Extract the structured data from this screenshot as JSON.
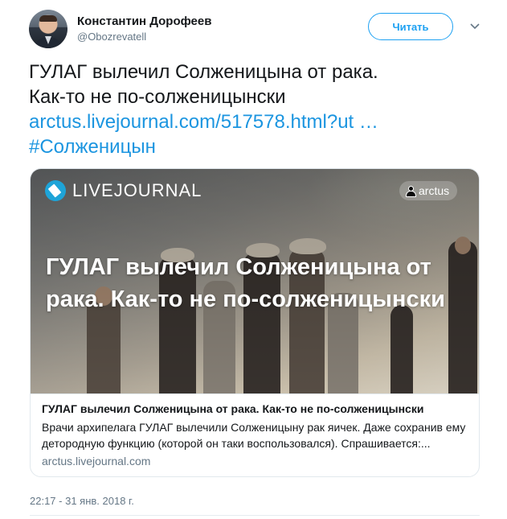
{
  "author": {
    "name": "Константин Дорофеев",
    "handle": "@Obozrevatell"
  },
  "follow_button": {
    "label": "Читать"
  },
  "menu_icon": "chevron-down-icon",
  "tweet": {
    "line1": "ГУЛАГ вылечил Солженицына от рака.",
    "line2": "Как-то не по-солженицынски",
    "link": "arctus.livejournal.com/517578.html?ut …",
    "hashtag": "#Солженицын"
  },
  "card": {
    "brand": "LIVEJOURNAL",
    "user": "arctus",
    "headline": "ГУЛАГ вылечил Солженицына от рака. Как-то не по-солженицынски",
    "title": "ГУЛАГ вылечил Солженицына от рака. Как-то не по-солженицынски",
    "description": "Врачи архипелага ГУЛАГ вылечили Солженицыну рак яичек. Даже сохранив ему детородную функцию (которой он таки воспользовался). Спрашивается:...",
    "domain": "arctus.livejournal.com"
  },
  "timestamp": "22:17 - 31 янв. 2018 г.",
  "colors": {
    "accent": "#1da1f2",
    "link": "#1b95e0",
    "secondary_text": "#657786",
    "livejournal_blue": "#1ea4d8"
  }
}
